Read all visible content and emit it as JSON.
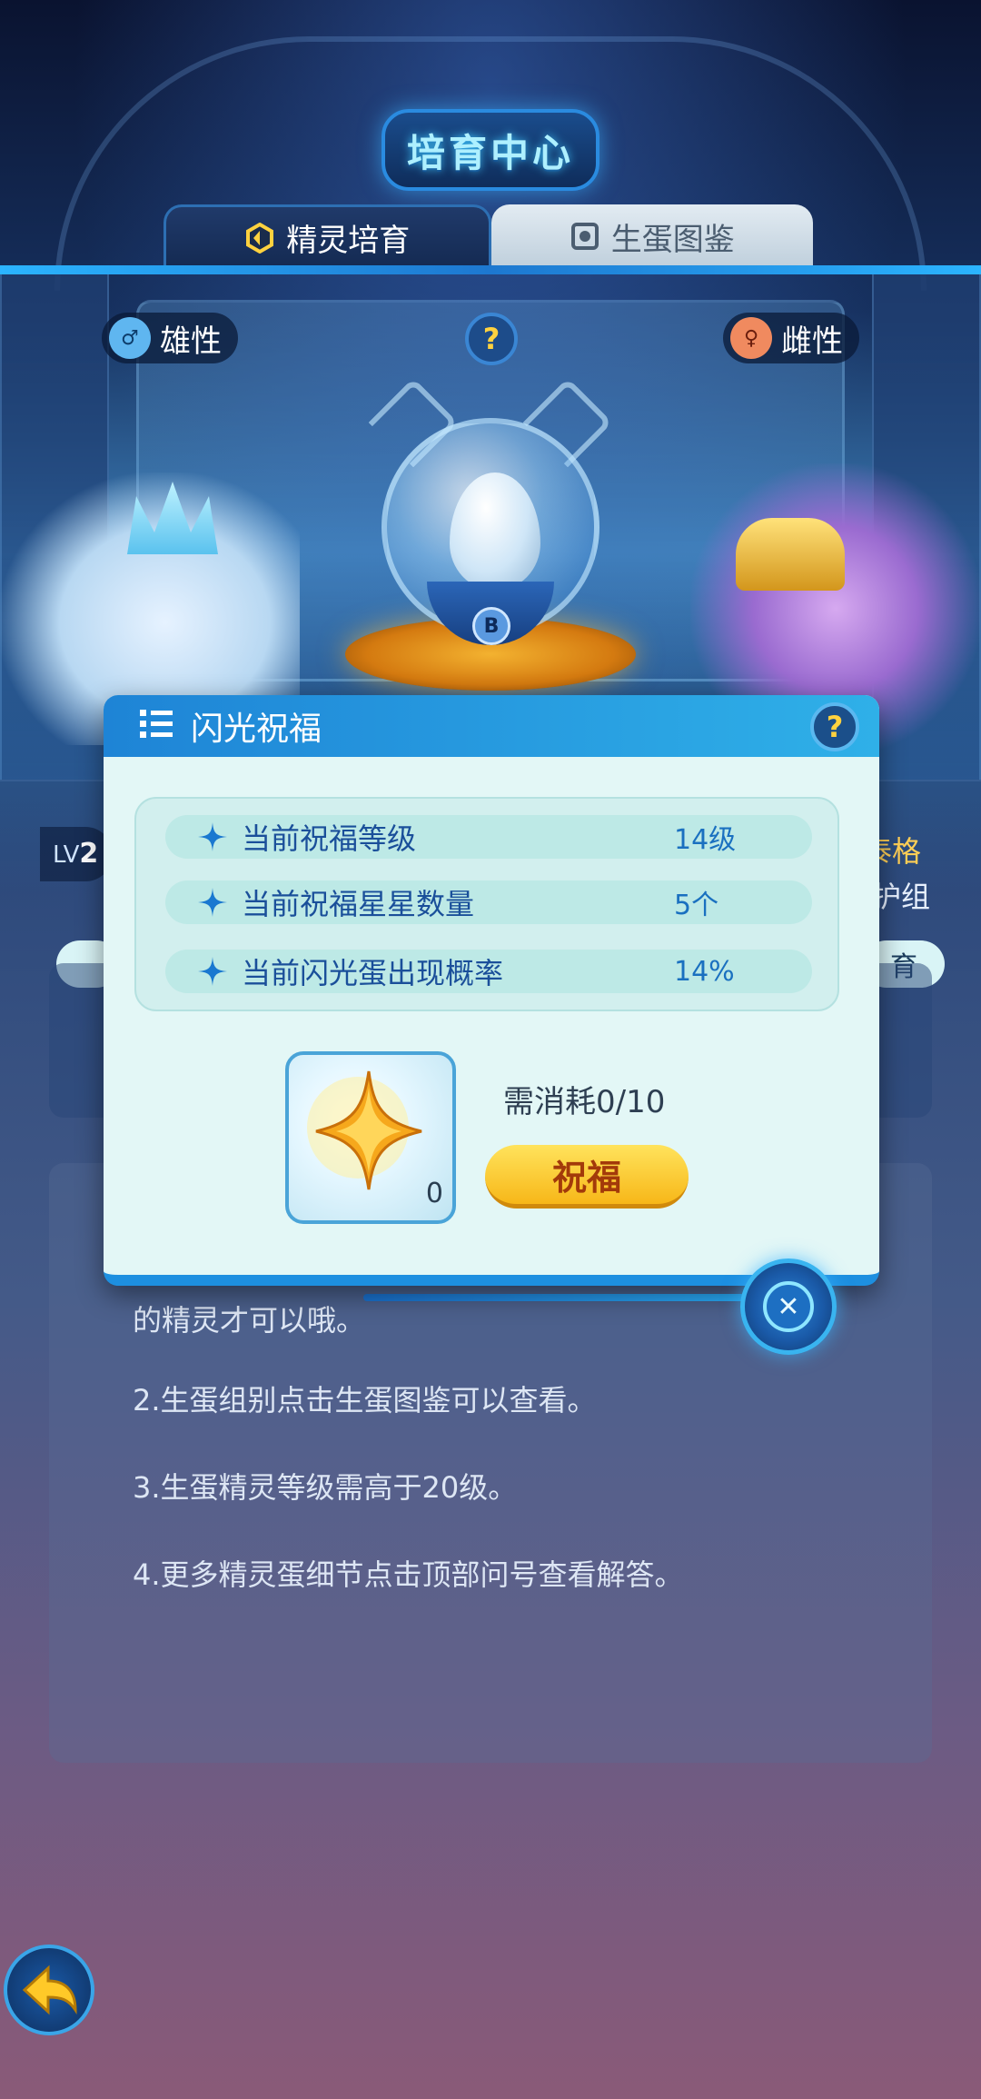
{
  "header": {
    "title": "培育中心",
    "tabs": [
      {
        "label": "精灵培育",
        "active": true
      },
      {
        "label": "生蛋图鉴",
        "active": false
      }
    ]
  },
  "parents": {
    "male_label": "雄性",
    "female_label": "雌性",
    "help_icon": "?",
    "left_level_prefix": "LV",
    "left_level_value": "2",
    "right_name_fragment": "泰格",
    "right_group_fragment": "护组",
    "right_button_fragment": "育"
  },
  "capsule": {
    "badge": "B"
  },
  "description": {
    "line1_fragment": "的精灵才可以哦。",
    "ghost_fragment": "组别",
    "line2": "2.生蛋组别点击生蛋图鉴可以查看。",
    "line3": "3.生蛋精灵等级需高于20级。",
    "line4": "4.更多精灵蛋细节点击顶部问号查看解答。"
  },
  "popup": {
    "title": "闪光祝福",
    "help_icon": "?",
    "stats": [
      {
        "label": "当前祝福等级",
        "value": "14级"
      },
      {
        "label": "当前祝福星星数量",
        "value": "5个"
      },
      {
        "label": "当前闪光蛋出现概率",
        "value": "14%"
      }
    ],
    "item": {
      "count": "0",
      "icon": "gold-star-icon"
    },
    "cost_text": "需消耗0/10",
    "bless_button": "祝福"
  },
  "colors": {
    "accent_blue": "#1e84d6",
    "button_yellow": "#f7b718",
    "popup_bg": "#e3f7f6",
    "stat_text": "#1a4f9a"
  }
}
